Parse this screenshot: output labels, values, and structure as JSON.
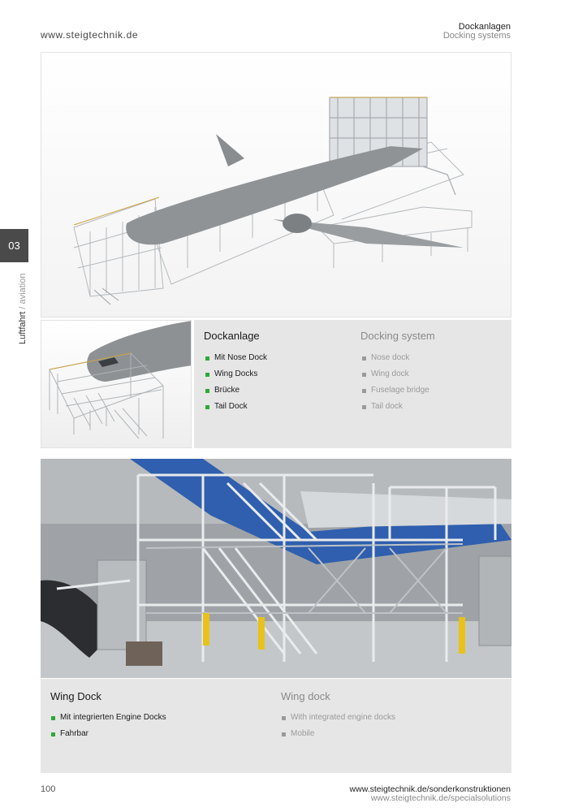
{
  "header": {
    "site_url": "www.steigtechnik.de",
    "section_de": "Dockanlagen",
    "section_en": "Docking systems"
  },
  "chapter": {
    "number": "03",
    "label_de": "Luftfahrt",
    "separator": "/",
    "label_en": "aviation"
  },
  "dockanlage": {
    "title_de": "Dockanlage",
    "title_en": "Docking system",
    "items_de": [
      "Mit Nose Dock",
      "Wing Docks",
      "Brücke",
      "Tail Dock"
    ],
    "items_en": [
      "Nose dock",
      "Wing dock",
      "Fuselage bridge",
      "Tail dock"
    ]
  },
  "wingdock": {
    "title_de": "Wing Dock",
    "title_en": "Wing dock",
    "items_de": [
      "Mit integrierten Engine Docks",
      "Fahrbar"
    ],
    "items_en": [
      "With integrated engine docks",
      "Mobile"
    ]
  },
  "footer": {
    "page_number": "100",
    "url_de": "www.steigtechnik.de/sonderkonstruktionen",
    "url_en": "www.steigtechnik.de/specialsolutions"
  },
  "colors": {
    "bullet_green": "#2ea836",
    "bullet_grey": "#9a9a9a",
    "chapter_tab": "#4a4a4a",
    "panel_bg": "#e6e6e6"
  }
}
